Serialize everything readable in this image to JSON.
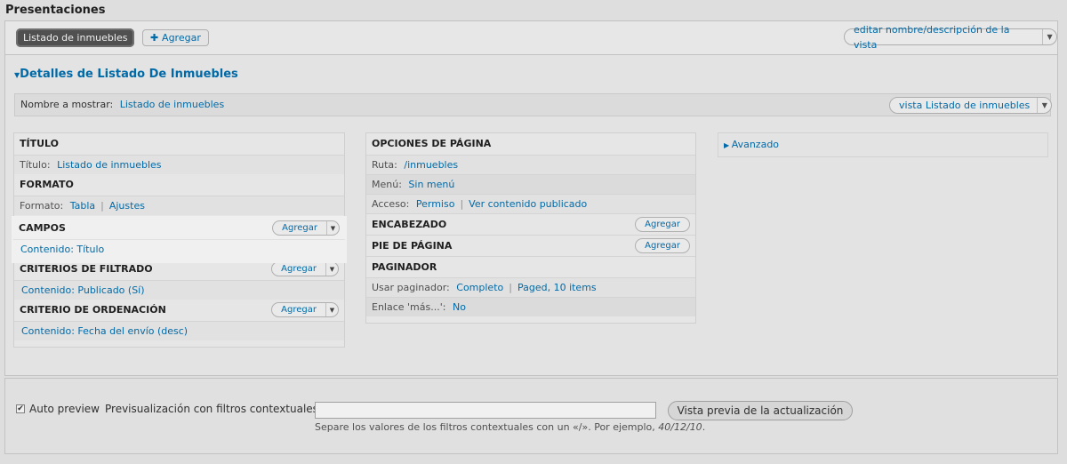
{
  "page": {
    "title": "Presentaciones"
  },
  "tabs": {
    "active": "Listado de inmuebles",
    "add": "Agregar",
    "edit_view": "editar nombre/descripción de la vista"
  },
  "details": {
    "heading": "Detalles de Listado De Inmuebles",
    "display_name_label": "Nombre a mostrar:",
    "display_name_value": "Listado de inmuebles",
    "view_dropdown": "vista Listado de inmuebles"
  },
  "left": {
    "titulo": {
      "head": "TÍTULO",
      "label": "Título:",
      "value": "Listado de inmuebles"
    },
    "formato": {
      "head": "FORMATO",
      "label": "Formato:",
      "value1": "Tabla",
      "sep": "|",
      "value2": "Ajustes"
    },
    "campos": {
      "head": "CAMPOS",
      "add": "Agregar",
      "item": "Contenido: Título"
    },
    "filtros": {
      "head": "CRITERIOS DE FILTRADO",
      "add": "Agregar",
      "item": "Contenido: Publicado (Sí)"
    },
    "orden": {
      "head": "CRITERIO DE ORDENACIÓN",
      "add": "Agregar",
      "item": "Contenido: Fecha del envío (desc)"
    }
  },
  "middle": {
    "pagina": {
      "head": "OPCIONES DE PÁGINA",
      "ruta_label": "Ruta:",
      "ruta_value": "/inmuebles",
      "menu_label": "Menú:",
      "menu_value": "Sin menú",
      "acceso_label": "Acceso:",
      "acceso_value1": "Permiso",
      "acceso_value2": "Ver contenido publicado"
    },
    "encabezado": {
      "head": "ENCABEZADO",
      "add": "Agregar"
    },
    "pie": {
      "head": "PIE DE PÁGINA",
      "add": "Agregar"
    },
    "paginador": {
      "head": "PAGINADOR",
      "usar_label": "Usar paginador:",
      "usar_value1": "Completo",
      "usar_value2": "Paged, 10 items",
      "enlace_label": "Enlace 'más...':",
      "enlace_value": "No"
    }
  },
  "right": {
    "avanzado": "Avanzado"
  },
  "bottom": {
    "auto_preview": "Auto preview",
    "ctx_label": "Previsualización con filtros contextuales:",
    "ctx_value": "",
    "hint_text": "Separe los valores de los filtros contextuales con un «/». Por ejemplo, ",
    "hint_example": "40/12/10",
    "hint_end": ".",
    "preview_button": "Vista previa de la actualización"
  }
}
